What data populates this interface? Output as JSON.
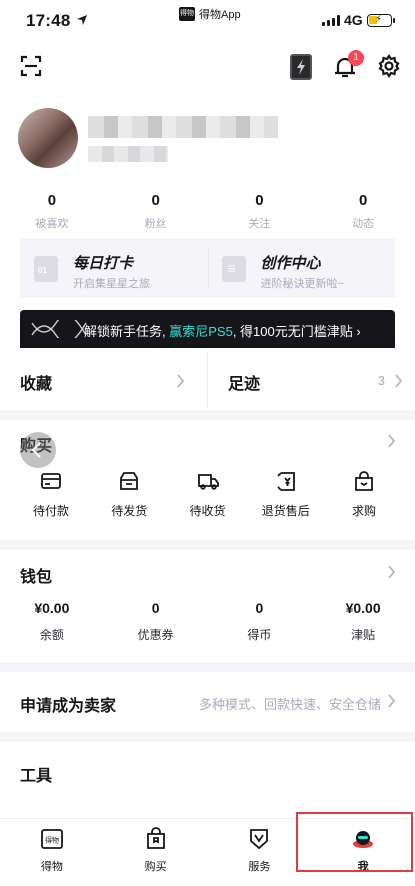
{
  "status_bar": {
    "time": "17:48",
    "app_name": "得物App",
    "app_badge": "得物",
    "network": "4G"
  },
  "colors": {
    "accent": "#34e0d3",
    "badge": "#ff4657",
    "highlight_box": "#e23b3b",
    "text_muted": "#aaaabb"
  },
  "toolbar": {
    "notification_count": "1",
    "icons": [
      "scan-icon",
      "flash-icon",
      "bell-icon",
      "gear-icon"
    ]
  },
  "stats": [
    {
      "value": "0",
      "label": "被喜欢"
    },
    {
      "value": "0",
      "label": "粉丝"
    },
    {
      "value": "0",
      "label": "关注"
    },
    {
      "value": "0",
      "label": "动态"
    }
  ],
  "cards": {
    "checkin": {
      "title": "每日打卡",
      "subtitle": "开启集星星之旅"
    },
    "creator": {
      "title": "创作中心",
      "subtitle": "进阶秘诀更新啦~"
    }
  },
  "banner": {
    "text_before": "解锁新手任务, ",
    "text_highlight": "赢索尼PS5",
    "text_after": ", 得100元无门槛津贴 ›"
  },
  "collect": {
    "label": "收藏"
  },
  "footprint": {
    "label": "足迹",
    "count": "3"
  },
  "purchase": {
    "title": "购买",
    "items": [
      {
        "label": "待付款",
        "icon": "card-icon"
      },
      {
        "label": "待发货",
        "icon": "box-icon"
      },
      {
        "label": "待收货",
        "icon": "truck-icon"
      },
      {
        "label": "退货售后",
        "icon": "refund-icon"
      },
      {
        "label": "求购",
        "icon": "bag-icon"
      }
    ]
  },
  "wallet": {
    "title": "钱包",
    "items": [
      {
        "value": "¥0.00",
        "label": "余额"
      },
      {
        "value": "0",
        "label": "优惠券"
      },
      {
        "value": "0",
        "label": "得币"
      },
      {
        "value": "¥0.00",
        "label": "津贴"
      }
    ]
  },
  "seller": {
    "title": "申请成为卖家",
    "subtitle": "多种模式、回款快速、安全仓储"
  },
  "tools": {
    "title": "工具"
  },
  "tabbar": {
    "items": [
      {
        "label": "得物",
        "icon": "home-logo-icon"
      },
      {
        "label": "购买",
        "icon": "shopping-bag-icon"
      },
      {
        "label": "服务",
        "icon": "service-shield-icon"
      },
      {
        "label": "我",
        "icon": "profile-avatar-icon",
        "active": true
      }
    ]
  }
}
